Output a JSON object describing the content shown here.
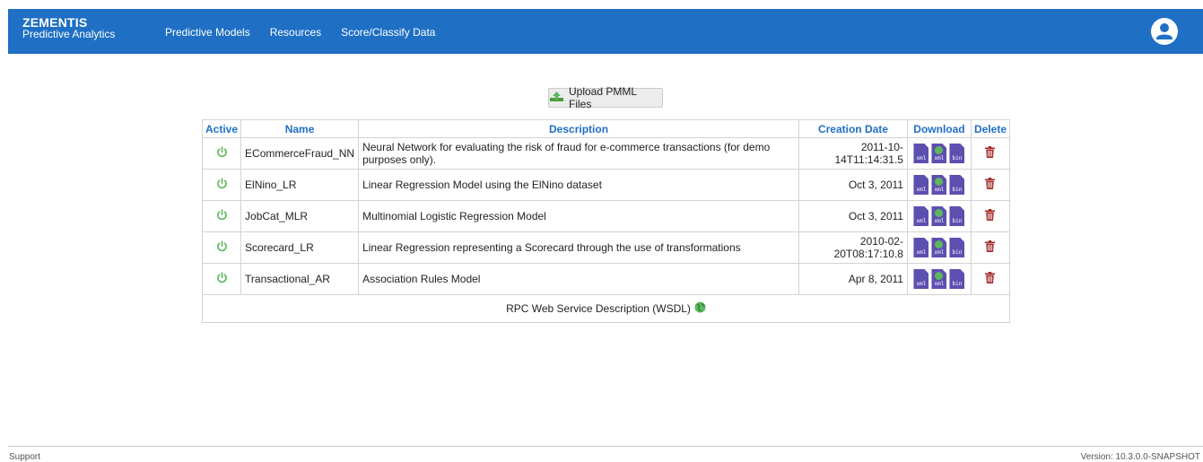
{
  "header": {
    "brand": "ZEMENTIS",
    "subtitle": "Predictive Analytics",
    "nav": [
      "Predictive Models",
      "Resources",
      "Score/Classify Data"
    ],
    "user_icon": "user-avatar-icon"
  },
  "upload": {
    "label": "Upload PMML Files",
    "icon": "upload-icon"
  },
  "table": {
    "columns": [
      "Active",
      "Name",
      "Description",
      "Creation Date",
      "Download",
      "Delete"
    ],
    "rows": [
      {
        "name": "ECommerceFraud_NN",
        "description": "Neural Network for evaluating the risk of fraud for e-commerce transactions (for demo purposes only).",
        "date": "2011-10-14T11:14:31.5"
      },
      {
        "name": "ElNino_LR",
        "description": "Linear Regression Model using the ElNino dataset",
        "date": "Oct 3, 2011"
      },
      {
        "name": "JobCat_MLR",
        "description": "Multinomial Logistic Regression Model",
        "date": "Oct 3, 2011"
      },
      {
        "name": "Scorecard_LR",
        "description": "Linear Regression representing a Scorecard through the use of transformations",
        "date": "2010-02-20T08:17:10.8"
      },
      {
        "name": "Transactional_AR",
        "description": "Association Rules Model",
        "date": "Apr 8, 2011"
      }
    ],
    "download_labels": [
      "xml",
      "xml",
      "bin"
    ],
    "active_icon": "power-icon",
    "delete_icon": "trash-icon",
    "colors": {
      "active": "#5cb85c",
      "delete": "#a52a2a",
      "header_text": "#1f6fc5"
    }
  },
  "wsdl": {
    "label": "RPC Web Service Description (WSDL)",
    "icon": "globe-icon"
  },
  "footer": {
    "support": "Support",
    "version": "Version: 10.3.0.0-SNAPSHOT"
  },
  "theme": {
    "topbar": "#1f6fc5"
  }
}
